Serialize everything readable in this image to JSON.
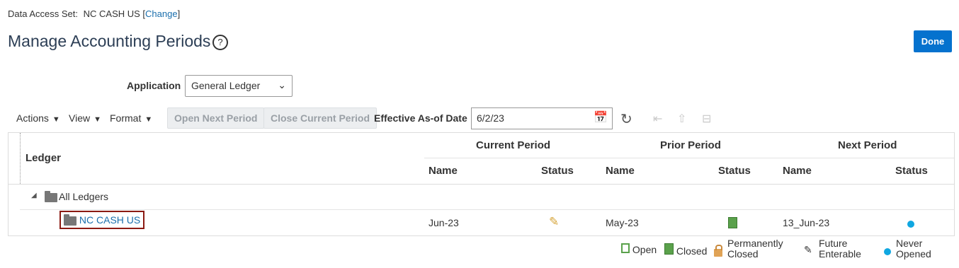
{
  "data_access": {
    "label": "Data Access Set:",
    "value": "NC CASH US",
    "change_label": "Change"
  },
  "page_title": "Manage Accounting Periods",
  "done_label": "Done",
  "application": {
    "label": "Application",
    "selected": "General Ledger"
  },
  "toolbar": {
    "actions": "Actions",
    "view": "View",
    "format": "Format",
    "open_next": "Open Next Period",
    "close_current": "Close Current Period",
    "effective_label": "Effective As-of Date",
    "effective_value": "6/2/23"
  },
  "table": {
    "ledger_header": "Ledger",
    "groups": [
      "Current Period",
      "Prior Period",
      "Next Period"
    ],
    "name_header": "Name",
    "status_header": "Status",
    "parent_row": "All Ledgers",
    "rows": [
      {
        "ledger": "NC CASH US",
        "current_name": "Jun-23",
        "current_status": "future-enterable-icon",
        "prior_name": "May-23",
        "prior_status": "closed-icon",
        "next_name": "13_Jun-23",
        "next_status": "never-opened-icon"
      }
    ]
  },
  "legend": {
    "open": "Open",
    "closed": "Closed",
    "perm_1": "Permanently",
    "perm_2": "Closed",
    "future_1": "Future",
    "future_2": "Enterable",
    "never_1": "Never",
    "never_2": "Opened"
  },
  "colors": {
    "accent": "#0572ce",
    "link": "#1b6fad",
    "highlight_border": "#8b1a12",
    "never_opened": "#10a7e1",
    "closed": "#5aa14b",
    "future": "#d6a53a"
  }
}
